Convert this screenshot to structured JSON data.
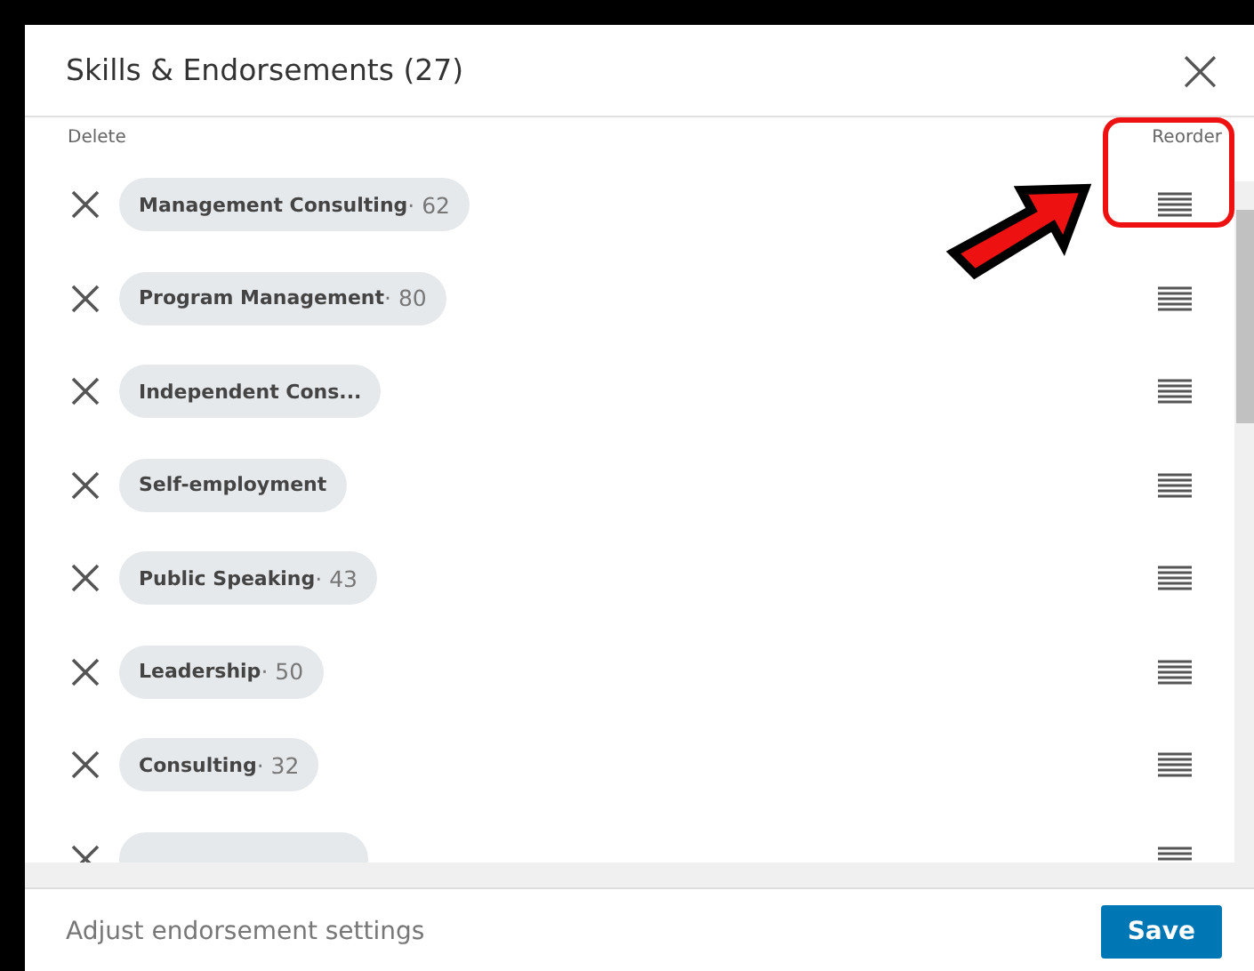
{
  "dialog": {
    "title": "Skills & Endorsements (27)",
    "close": "×"
  },
  "columns": {
    "delete": "Delete",
    "reorder": "Reorder"
  },
  "skills": [
    {
      "name": "Management Consulting",
      "count": "· 62"
    },
    {
      "name": "Program Management",
      "count": "· 80"
    },
    {
      "name": "Independent Cons..."
    },
    {
      "name": "Self-employment"
    },
    {
      "name": "Public Speaking",
      "count": "· 43"
    },
    {
      "name": "Leadership",
      "count": "· 50"
    },
    {
      "name": "Consulting",
      "count": "· 32"
    },
    {
      "kind": "cut"
    }
  ],
  "footer": {
    "link": "Adjust endorsement settings",
    "button": "Save"
  }
}
